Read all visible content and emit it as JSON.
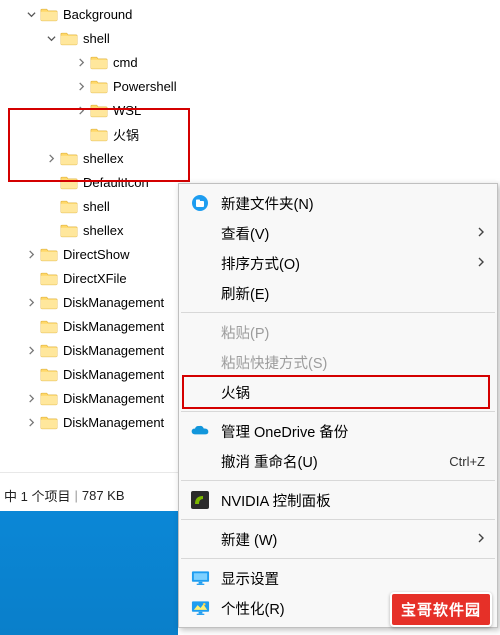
{
  "tree": [
    {
      "indent": 24,
      "twisty": "down",
      "label": "Background"
    },
    {
      "indent": 44,
      "twisty": "down",
      "label": "shell"
    },
    {
      "indent": 74,
      "twisty": "right",
      "label": "cmd"
    },
    {
      "indent": 74,
      "twisty": "right",
      "label": "Powershell"
    },
    {
      "indent": 74,
      "twisty": "right",
      "label": "WSL"
    },
    {
      "indent": 74,
      "twisty": "",
      "label": "火锅"
    },
    {
      "indent": 44,
      "twisty": "right",
      "label": "shellex"
    },
    {
      "indent": 44,
      "twisty": "",
      "label": "DefaultIcon"
    },
    {
      "indent": 44,
      "twisty": "",
      "label": "shell"
    },
    {
      "indent": 44,
      "twisty": "",
      "label": "shellex"
    },
    {
      "indent": 24,
      "twisty": "right",
      "label": "DirectShow"
    },
    {
      "indent": 24,
      "twisty": "",
      "label": "DirectXFile"
    },
    {
      "indent": 24,
      "twisty": "right",
      "label": "DiskManagement"
    },
    {
      "indent": 24,
      "twisty": "",
      "label": "DiskManagement"
    },
    {
      "indent": 24,
      "twisty": "right",
      "label": "DiskManagement"
    },
    {
      "indent": 24,
      "twisty": "",
      "label": "DiskManagement"
    },
    {
      "indent": 24,
      "twisty": "right",
      "label": "DiskManagement"
    },
    {
      "indent": 24,
      "twisty": "right",
      "label": "DiskManagement"
    }
  ],
  "statusbar": {
    "left": "中 1 个项目",
    "right": "787 KB"
  },
  "menu": {
    "items": [
      {
        "icon": "new-folder",
        "label": "新建文件夹(N)"
      },
      {
        "label": "查看(V)",
        "arrow": true
      },
      {
        "label": "排序方式(O)",
        "arrow": true
      },
      {
        "label": "刷新(E)"
      },
      {
        "sep": true
      },
      {
        "label": "粘贴(P)",
        "disabled": true
      },
      {
        "label": "粘贴快捷方式(S)",
        "disabled": true
      },
      {
        "label": "火锅"
      },
      {
        "sep": true
      },
      {
        "icon": "onedrive",
        "label": "管理 OneDrive 备份"
      },
      {
        "label": "撤消 重命名(U)",
        "shortcut": "Ctrl+Z"
      },
      {
        "sep": true
      },
      {
        "icon": "nvidia",
        "label": "NVIDIA 控制面板"
      },
      {
        "sep": true
      },
      {
        "label": "新建 (W)",
        "arrow": true
      },
      {
        "sep": true
      },
      {
        "icon": "display",
        "label": "显示设置"
      },
      {
        "icon": "personalize",
        "label": "个性化(R)"
      }
    ]
  },
  "brand": "宝哥软件园"
}
